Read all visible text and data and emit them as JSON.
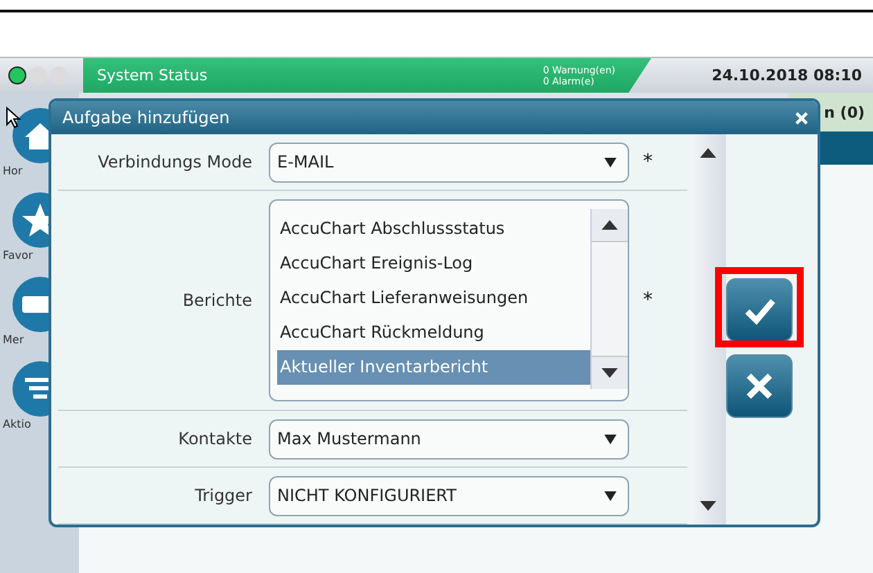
{
  "top_bar": {
    "indicators": [
      {
        "on": true
      },
      {
        "on": false
      },
      {
        "on": false
      }
    ],
    "title": "System Status",
    "warnings": "0 Warnung(en)",
    "alarms": "0 Alarm(e)",
    "datetime": "24.10.2018 08:10"
  },
  "sidebar": {
    "items": [
      {
        "kind": "home",
        "label": "Hor"
      },
      {
        "kind": "star",
        "label": "Favor"
      },
      {
        "kind": "menu",
        "label": "Mer"
      },
      {
        "kind": "actions",
        "label": "Aktio"
      }
    ]
  },
  "background_tab": "n (0)",
  "dialog": {
    "title": "Aufgabe hinzufügen",
    "fields": [
      {
        "kind": "select",
        "label": "Verbindungs Mode",
        "value": "E-MAIL",
        "required_mark": "*"
      },
      {
        "kind": "list",
        "label": "Berichte",
        "required_mark": "*",
        "options": [
          {
            "label": "AccuChart Abschlussstatus",
            "selected": false
          },
          {
            "label": "AccuChart Ereignis-Log",
            "selected": false
          },
          {
            "label": "AccuChart Lieferanweisungen",
            "selected": false
          },
          {
            "label": "AccuChart Rückmeldung",
            "selected": false
          },
          {
            "label": "Aktueller Inventarbericht",
            "selected": true
          }
        ]
      },
      {
        "kind": "select",
        "label": "Kontakte",
        "value": "Max Mustermann"
      },
      {
        "kind": "select",
        "label": "Trigger",
        "value": "NICHT KONFIGURIERT"
      }
    ],
    "buttons": [
      {
        "kind": "confirm",
        "highlighted": true
      },
      {
        "kind": "cancel",
        "highlighted": false
      }
    ]
  }
}
